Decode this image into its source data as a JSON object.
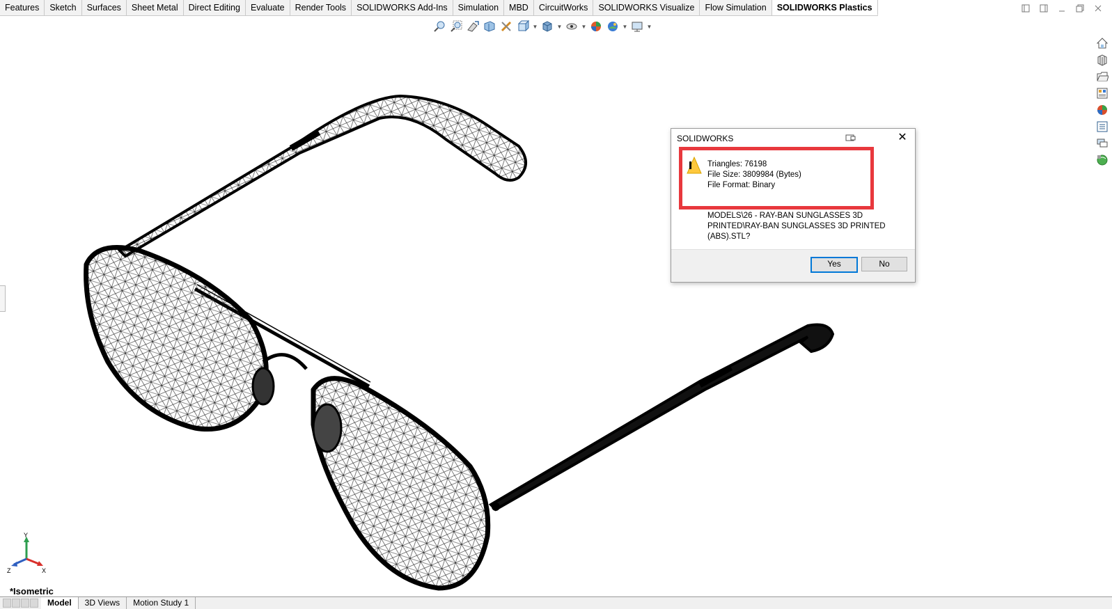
{
  "tabs": [
    "Features",
    "Sketch",
    "Surfaces",
    "Sheet Metal",
    "Direct Editing",
    "Evaluate",
    "Render Tools",
    "SOLIDWORKS Add-Ins",
    "Simulation",
    "MBD",
    "CircuitWorks",
    "SOLIDWORKS Visualize",
    "Flow Simulation",
    "SOLIDWORKS Plastics"
  ],
  "active_tab": "SOLIDWORKS Plastics",
  "dialog": {
    "title": "SOLIDWORKS",
    "triangles": "Triangles: 76198",
    "file_size": "File Size: 3809984 (Bytes)",
    "file_format": "File Format: Binary",
    "path_line1": "MODELS\\26 - RAY-BAN SUNGLASSES 3D",
    "path_line2": "PRINTED\\RAY-BAN SUNGLASSES 3D PRINTED",
    "path_line3": "(ABS).STL?",
    "yes_label": "Yes",
    "no_label": "No"
  },
  "view_name": "*Isometric",
  "triad": {
    "y": "Y",
    "x": "X",
    "z": "Z"
  },
  "bottom_tabs": [
    "Model",
    "3D Views",
    "Motion Study 1"
  ],
  "active_bottom_tab": "Model",
  "colors": {
    "highlight": "#e8383d",
    "default_button_border": "#0078d7"
  }
}
